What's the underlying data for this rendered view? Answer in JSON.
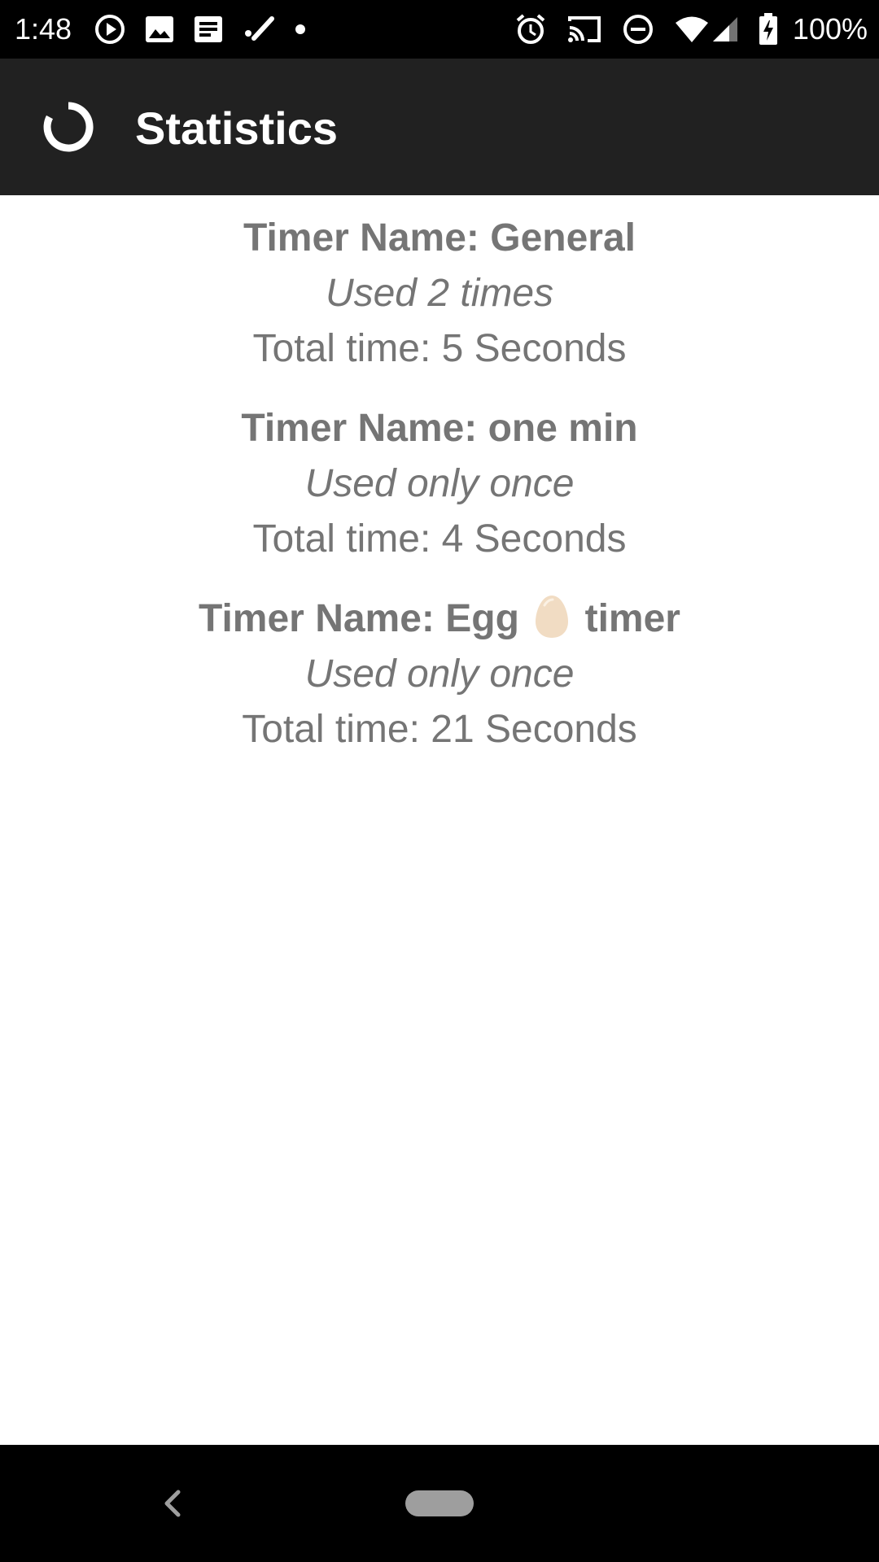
{
  "status_bar": {
    "time": "1:48",
    "battery": "100%",
    "left_icons": [
      "play-circle-icon",
      "image-icon",
      "message-icon",
      "edit-icon",
      "dot-icon"
    ],
    "right_icons": [
      "alarm-icon",
      "cast-icon",
      "do-not-disturb-icon",
      "wifi-icon",
      "signal-icon",
      "battery-charging-icon"
    ]
  },
  "app_bar": {
    "title": "Statistics",
    "icon": "loading-ring-icon"
  },
  "stats": [
    {
      "name": "Timer Name: General",
      "usage": "Used 2 times",
      "total": "Total time: 5 Seconds"
    },
    {
      "name": "Timer Name: one min",
      "usage": "Used only once",
      "total": "Total time: 4 Seconds"
    },
    {
      "name_prefix": "Timer Name: Egg",
      "name_emoji": "egg-icon",
      "name_suffix": "timer",
      "usage": "Used only once",
      "total": "Total time: 21 Seconds"
    }
  ],
  "nav_bar": {
    "back_icon": "back-chevron-icon",
    "home_icon": "home-pill-icon"
  },
  "colors": {
    "app_bar": "#212121",
    "status_bar": "#000000",
    "text": "#757575",
    "egg": "#f1dcc3"
  }
}
